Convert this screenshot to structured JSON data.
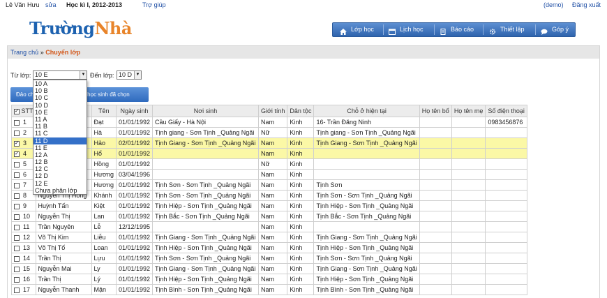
{
  "top": {
    "user_name": "Lê Văn Hưu",
    "edit_link": "sửa",
    "semester": "Học kì I, 2012-2013",
    "help_link": "Trợ giúp",
    "demo": "(demo)",
    "logout_link": "Đăng xuất"
  },
  "logo": {
    "part1": "Trường",
    "part2": "Nhà"
  },
  "nav": {
    "items": [
      {
        "label": "Lớp học",
        "icon": "home-icon"
      },
      {
        "label": "Lịch học",
        "icon": "calendar-icon"
      },
      {
        "label": "Báo cáo",
        "icon": "report-icon"
      },
      {
        "label": "Thiết lập",
        "icon": "gear-icon"
      },
      {
        "label": "Góp ý",
        "icon": "chat-icon"
      }
    ]
  },
  "breadcrumb": {
    "home": "Trang chủ",
    "separator": "»",
    "current": "Chuyển lớp"
  },
  "form": {
    "from_label": "Từ lớp:",
    "from_value": "10 E",
    "to_label": "Đến lớp:",
    "to_value": "10 D"
  },
  "buttons": {
    "btn1": "Đảo chọn",
    "btn2": "Chuyển những học sinh đã chọn"
  },
  "dropdown_options": [
    "10 A",
    "10 B",
    "10 C",
    "10 D",
    "10 E",
    "11 A",
    "11 B",
    "11 C",
    "11 D",
    "11 E",
    "12 A",
    "12 B",
    "12 C",
    "12 D",
    "12 E",
    "Chưa phân lớp"
  ],
  "dropdown_selected": "11 D",
  "table": {
    "headers": [
      "STT",
      "",
      "Tên",
      "Ngày sinh",
      "Nơi sinh",
      "Giới tính",
      "Dân tộc",
      "Chỗ ở hiện tại",
      "Họ tên bố",
      "Họ tên mẹ",
      "Số điện thoại"
    ],
    "rows": [
      {
        "checked": false,
        "highlight": false,
        "stt": "1",
        "ho": "",
        "ten": "Đạt",
        "ngay_sinh": "01/01/1992",
        "noi_sinh": "Cầu Giấy - Hà Nội",
        "gioi_tinh": "Nam",
        "dan_toc": "Kinh",
        "cho_o": "16- Trần Đăng Ninh",
        "bo": "",
        "me": "",
        "sdt": "0983456876"
      },
      {
        "checked": false,
        "highlight": false,
        "stt": "2",
        "ho": "",
        "ten": "Hà",
        "ngay_sinh": "01/01/1992",
        "noi_sinh": "Tịnh giang - Sơn Tịnh _Quảng Ngãi",
        "gioi_tinh": "Nữ",
        "dan_toc": "Kinh",
        "cho_o": "Tịnh giang - Sơn Tịnh _Quảng Ngãi",
        "bo": "",
        "me": "",
        "sdt": ""
      },
      {
        "checked": true,
        "highlight": true,
        "stt": "3",
        "ho": "",
        "ten": "Hảo",
        "ngay_sinh": "02/01/1992",
        "noi_sinh": "Tịnh Giang - Sơn Tịnh _Quảng Ngãi",
        "gioi_tinh": "Nam",
        "dan_toc": "Kinh",
        "cho_o": "Tịnh Giang - Sơn Tịnh _Quảng Ngãi",
        "bo": "",
        "me": "",
        "sdt": ""
      },
      {
        "checked": true,
        "highlight": true,
        "stt": "4",
        "ho": "",
        "ten": "Hổ",
        "ngay_sinh": "01/01/1992",
        "noi_sinh": "",
        "gioi_tinh": "Nam",
        "dan_toc": "Kinh",
        "cho_o": "",
        "bo": "",
        "me": "",
        "sdt": ""
      },
      {
        "checked": false,
        "highlight": false,
        "stt": "5",
        "ho": "",
        "ten": "Hồng",
        "ngay_sinh": "01/01/1992",
        "noi_sinh": "",
        "gioi_tinh": "Nữ",
        "dan_toc": "Kinh",
        "cho_o": "",
        "bo": "",
        "me": "",
        "sdt": ""
      },
      {
        "checked": false,
        "highlight": false,
        "stt": "6",
        "ho": "",
        "ten": "Hương",
        "ngay_sinh": "03/04/1996",
        "noi_sinh": "",
        "gioi_tinh": "Nam",
        "dan_toc": "Kinh",
        "cho_o": "",
        "bo": "",
        "me": "",
        "sdt": ""
      },
      {
        "checked": false,
        "highlight": false,
        "stt": "7",
        "ho": "",
        "ten": "Hương",
        "ngay_sinh": "01/01/1992",
        "noi_sinh": "Tịnh Sơn - Sơn Tịnh _Quảng Ngãi",
        "gioi_tinh": "Nam",
        "dan_toc": "Kinh",
        "cho_o": "Tịnh Sơn",
        "bo": "",
        "me": "",
        "sdt": ""
      },
      {
        "checked": false,
        "highlight": false,
        "stt": "8",
        "ho": "Nguyễn Thị Hồng",
        "ten": "Khánh",
        "ngay_sinh": "01/01/1992",
        "noi_sinh": "Tịnh Sơn - Sơn Tịnh _Quảng Ngãi",
        "gioi_tinh": "Nam",
        "dan_toc": "Kinh",
        "cho_o": "Tịnh Sơn - Sơn Tịnh _Quảng Ngãi",
        "bo": "",
        "me": "",
        "sdt": ""
      },
      {
        "checked": false,
        "highlight": false,
        "stt": "9",
        "ho": "Huỳnh Tấn",
        "ten": "Kiệt",
        "ngay_sinh": "01/01/1992",
        "noi_sinh": "Tịnh Hiệp - Sơn Tịnh _Quảng Ngãi",
        "gioi_tinh": "Nam",
        "dan_toc": "Kinh",
        "cho_o": "Tịnh Hiệp - Sơn Tịnh _Quảng Ngãi",
        "bo": "",
        "me": "",
        "sdt": ""
      },
      {
        "checked": false,
        "highlight": false,
        "stt": "10",
        "ho": "Nguyễn Thị",
        "ten": "Lan",
        "ngay_sinh": "01/01/1992",
        "noi_sinh": "Tịnh Bắc - Sơn Tịnh _Quảng Ngãi",
        "gioi_tinh": "Nam",
        "dan_toc": "Kinh",
        "cho_o": "Tịnh Bắc - Sơn Tịnh _Quảng Ngãi",
        "bo": "",
        "me": "",
        "sdt": ""
      },
      {
        "checked": false,
        "highlight": false,
        "stt": "11",
        "ho": "Trần Nguyên",
        "ten": "Lễ",
        "ngay_sinh": "12/12/1995",
        "noi_sinh": "",
        "gioi_tinh": "Nam",
        "dan_toc": "Kinh",
        "cho_o": "",
        "bo": "",
        "me": "",
        "sdt": ""
      },
      {
        "checked": false,
        "highlight": false,
        "stt": "12",
        "ho": "Võ Thị Kim",
        "ten": "Liễu",
        "ngay_sinh": "01/01/1992",
        "noi_sinh": "Tịnh Giang - Sơn Tịnh _Quảng Ngãi",
        "gioi_tinh": "Nam",
        "dan_toc": "Kinh",
        "cho_o": "Tịnh Giang - Sơn Tịnh _Quảng Ngãi",
        "bo": "",
        "me": "",
        "sdt": ""
      },
      {
        "checked": false,
        "highlight": false,
        "stt": "13",
        "ho": "Võ Thị Tố",
        "ten": "Loan",
        "ngay_sinh": "01/01/1992",
        "noi_sinh": "Tịnh Hiệp - Sơn Tịnh _Quảng Ngãi",
        "gioi_tinh": "Nam",
        "dan_toc": "Kinh",
        "cho_o": "Tịnh Hiệp - Sơn Tịnh _Quảng Ngãi",
        "bo": "",
        "me": "",
        "sdt": ""
      },
      {
        "checked": false,
        "highlight": false,
        "stt": "14",
        "ho": "Trần Thị",
        "ten": "Lựu",
        "ngay_sinh": "01/01/1992",
        "noi_sinh": "Tịnh Sơn - Sơn Tịnh _Quảng Ngãi",
        "gioi_tinh": "Nam",
        "dan_toc": "Kinh",
        "cho_o": "Tịnh Sơn - Sơn Tịnh _Quảng Ngãi",
        "bo": "",
        "me": "",
        "sdt": ""
      },
      {
        "checked": false,
        "highlight": false,
        "stt": "15",
        "ho": "Nguyễn Mai",
        "ten": "Ly",
        "ngay_sinh": "01/01/1992",
        "noi_sinh": "Tịnh Giang - Sơn Tịnh _Quảng Ngãi",
        "gioi_tinh": "Nam",
        "dan_toc": "Kinh",
        "cho_o": "Tịnh Giang - Sơn Tịnh _Quảng Ngãi",
        "bo": "",
        "me": "",
        "sdt": ""
      },
      {
        "checked": false,
        "highlight": false,
        "stt": "16",
        "ho": "Trần Thị",
        "ten": "Lý",
        "ngay_sinh": "01/01/1992",
        "noi_sinh": "Tịnh Hiệp - Sơn Tịnh _Quảng Ngãi",
        "gioi_tinh": "Nam",
        "dan_toc": "Kinh",
        "cho_o": "Tịnh Hiệp - Sơn Tịnh _Quảng Ngãi",
        "bo": "",
        "me": "",
        "sdt": ""
      },
      {
        "checked": false,
        "highlight": false,
        "stt": "17",
        "ho": "Nguyễn Thanh",
        "ten": "Mận",
        "ngay_sinh": "01/01/1992",
        "noi_sinh": "Tịnh Bình - Sơn Tịnh _Quảng Ngãi",
        "gioi_tinh": "Nam",
        "dan_toc": "Kinh",
        "cho_o": "Tịnh Bình - Sơn Tịnh _Quảng Ngãi",
        "bo": "",
        "me": "",
        "sdt": ""
      }
    ]
  }
}
